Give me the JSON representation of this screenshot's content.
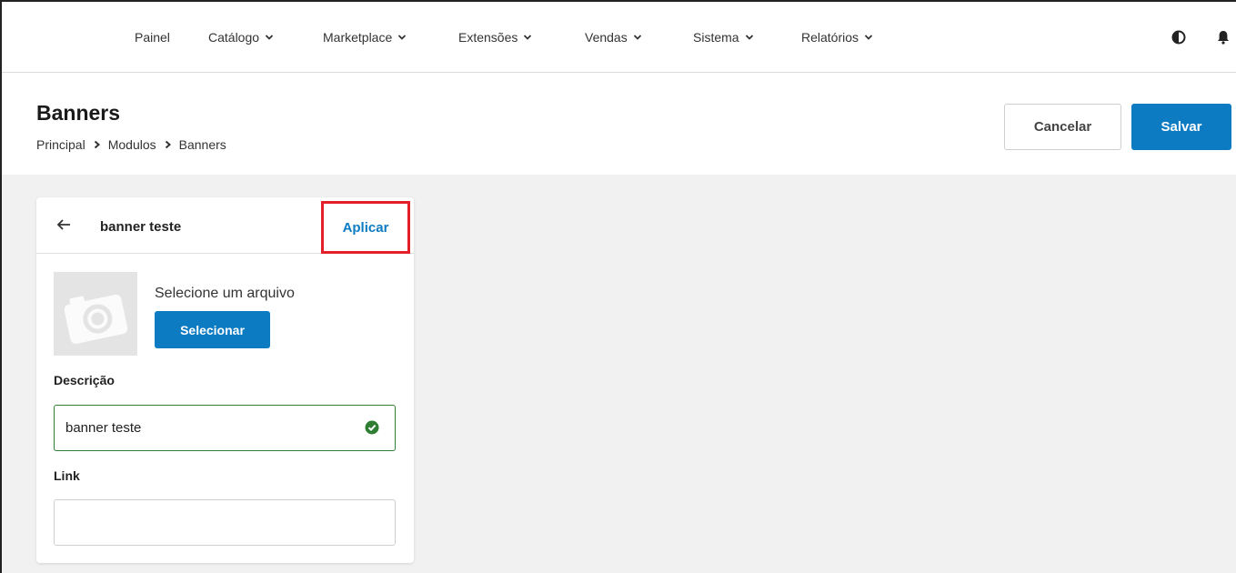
{
  "nav": {
    "items": [
      {
        "label": "Painel",
        "dropdown": false
      },
      {
        "label": "Catálogo",
        "dropdown": true
      },
      {
        "label": "Marketplace",
        "dropdown": true
      },
      {
        "label": "Extensões",
        "dropdown": true
      },
      {
        "label": "Vendas",
        "dropdown": true
      },
      {
        "label": "Sistema",
        "dropdown": true
      },
      {
        "label": "Relatórios",
        "dropdown": true
      }
    ],
    "icons": [
      "contrast-icon",
      "bell-icon"
    ]
  },
  "header": {
    "title": "Banners",
    "breadcrumb": [
      "Principal",
      "Modulos",
      "Banners"
    ],
    "cancel_label": "Cancelar",
    "save_label": "Salvar"
  },
  "card": {
    "title": "banner teste",
    "apply_label": "Aplicar",
    "file_prompt": "Selecione um arquivo",
    "select_label": "Selecionar",
    "description_label": "Descrição",
    "description_value": "banner teste",
    "description_valid": true,
    "link_label": "Link",
    "link_value": ""
  },
  "colors": {
    "primary": "#0d7bc2",
    "highlight_border": "#e3202a",
    "valid": "#2e7d32",
    "content_bg": "#f1f1f1"
  }
}
